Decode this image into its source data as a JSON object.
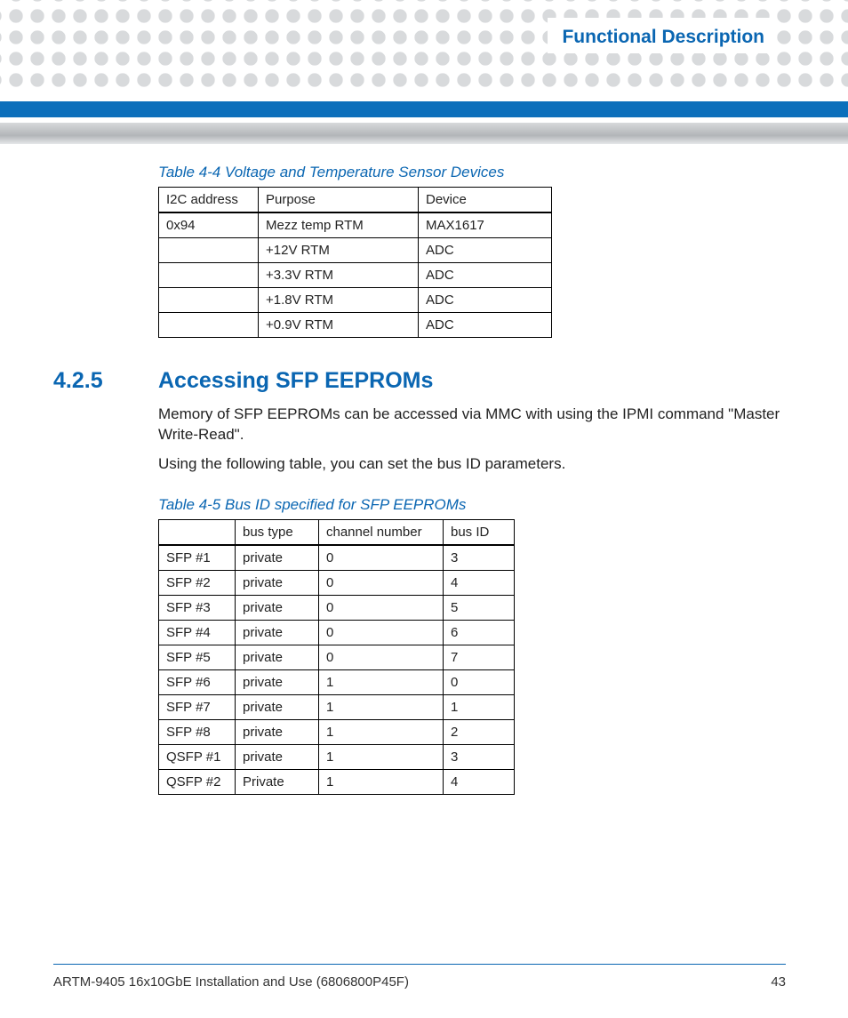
{
  "chapter": "Functional Description",
  "table1": {
    "caption": "Table 4-4 Voltage and Temperature Sensor Devices",
    "headers": [
      "I2C address",
      "Purpose",
      "Device"
    ],
    "rows": [
      [
        "0x94",
        "Mezz temp RTM",
        "MAX1617"
      ],
      [
        "",
        "+12V RTM",
        "ADC"
      ],
      [
        "",
        "+3.3V RTM",
        "ADC"
      ],
      [
        "",
        "+1.8V RTM",
        "ADC"
      ],
      [
        "",
        "+0.9V RTM",
        "ADC"
      ]
    ]
  },
  "section": {
    "number": "4.2.5",
    "title": "Accessing SFP EEPROMs",
    "para1": "Memory of SFP EEPROMs can be accessed via MMC with using the IPMI command \"Master Write-Read\".",
    "para2": "Using the following table, you can set the bus ID parameters."
  },
  "table2": {
    "caption": "Table 4-5 Bus ID specified for SFP EEPROMs",
    "headers": [
      "",
      "bus type",
      "channel number",
      "bus ID"
    ],
    "rows": [
      [
        "SFP #1",
        "private",
        "0",
        "3"
      ],
      [
        "SFP #2",
        "private",
        "0",
        "4"
      ],
      [
        "SFP #3",
        "private",
        "0",
        "5"
      ],
      [
        "SFP #4",
        "private",
        "0",
        "6"
      ],
      [
        "SFP #5",
        "private",
        "0",
        "7"
      ],
      [
        "SFP #6",
        "private",
        "1",
        "0"
      ],
      [
        "SFP #7",
        "private",
        "1",
        "1"
      ],
      [
        "SFP #8",
        "private",
        "1",
        "2"
      ],
      [
        "QSFP #1",
        "private",
        "1",
        "3"
      ],
      [
        "QSFP #2",
        "Private",
        "1",
        "4"
      ]
    ]
  },
  "footer": {
    "left": "ARTM-9405 16x10GbE Installation and Use (6806800P45F)",
    "right": "43"
  }
}
